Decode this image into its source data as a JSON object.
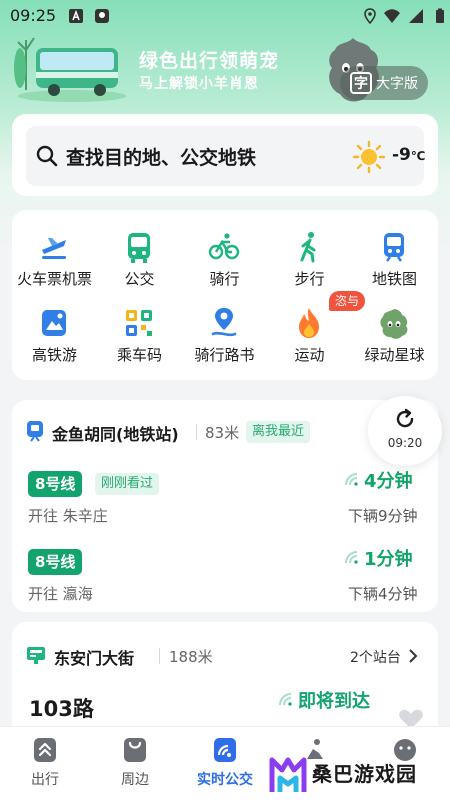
{
  "status_bar": {
    "time": "09:25",
    "icons": [
      "font-a-icon",
      "map-pin-icon",
      "location-icon",
      "wifi-icon",
      "signal-icon",
      "battery-icon"
    ]
  },
  "banner": {
    "title": "绿色出行领萌宠",
    "subtitle": "马上解锁小羊肖恩",
    "big_font_glyph": "字",
    "big_font_label": "大字版"
  },
  "search": {
    "placeholder": "查找目的地、公交地铁",
    "temperature": "-9",
    "temperature_unit": "℃"
  },
  "grid": {
    "items": [
      {
        "label": "火车票机票",
        "icon": "train-plane-icon"
      },
      {
        "label": "公交",
        "icon": "bus-icon"
      },
      {
        "label": "骑行",
        "icon": "bike-icon"
      },
      {
        "label": "步行",
        "icon": "walk-icon"
      },
      {
        "label": "地铁图",
        "icon": "metro-map-icon"
      },
      {
        "label": "高铁游",
        "icon": "high-speed-rail-icon"
      },
      {
        "label": "乘车码",
        "icon": "qr-code-icon"
      },
      {
        "label": "骑行路书",
        "icon": "route-pin-icon"
      },
      {
        "label": "运动",
        "icon": "flame-icon"
      },
      {
        "label": "绿动星球",
        "icon": "green-planet-icon"
      }
    ],
    "hot_badge": "恣与"
  },
  "subway": {
    "station": "金鱼胡同(地铁站)",
    "distance": "83米",
    "near_tag": "离我最近",
    "refresh_time": "09:20",
    "lines": [
      {
        "line": "8号线",
        "tag": "刚刚看过",
        "direction": "开往 朱辛庄",
        "arrival": "4分钟",
        "next": "下辆9分钟"
      },
      {
        "line": "8号线",
        "tag": "",
        "direction": "开往 瀛海",
        "arrival": "1分钟",
        "next": "下辆4分钟"
      }
    ]
  },
  "bus": {
    "station": "东安门大街",
    "distance": "188米",
    "stations_link": "2个站台",
    "route": "103路",
    "arrival": "即将到达"
  },
  "bottom_nav": {
    "items": [
      {
        "label": "出行",
        "icon": "travel-icon"
      },
      {
        "label": "周边",
        "icon": "nearby-bag-icon"
      },
      {
        "label": "实时公交",
        "icon": "realtime-bus-icon"
      },
      {
        "label": "",
        "icon": "rider-icon"
      },
      {
        "label": "",
        "icon": "profile-icon"
      }
    ]
  },
  "watermark": {
    "text": "桑巴游戏园"
  },
  "colors": {
    "accent_green": "#13a36c",
    "active_blue": "#2f6ee8",
    "hot_red": "#f0543f"
  }
}
